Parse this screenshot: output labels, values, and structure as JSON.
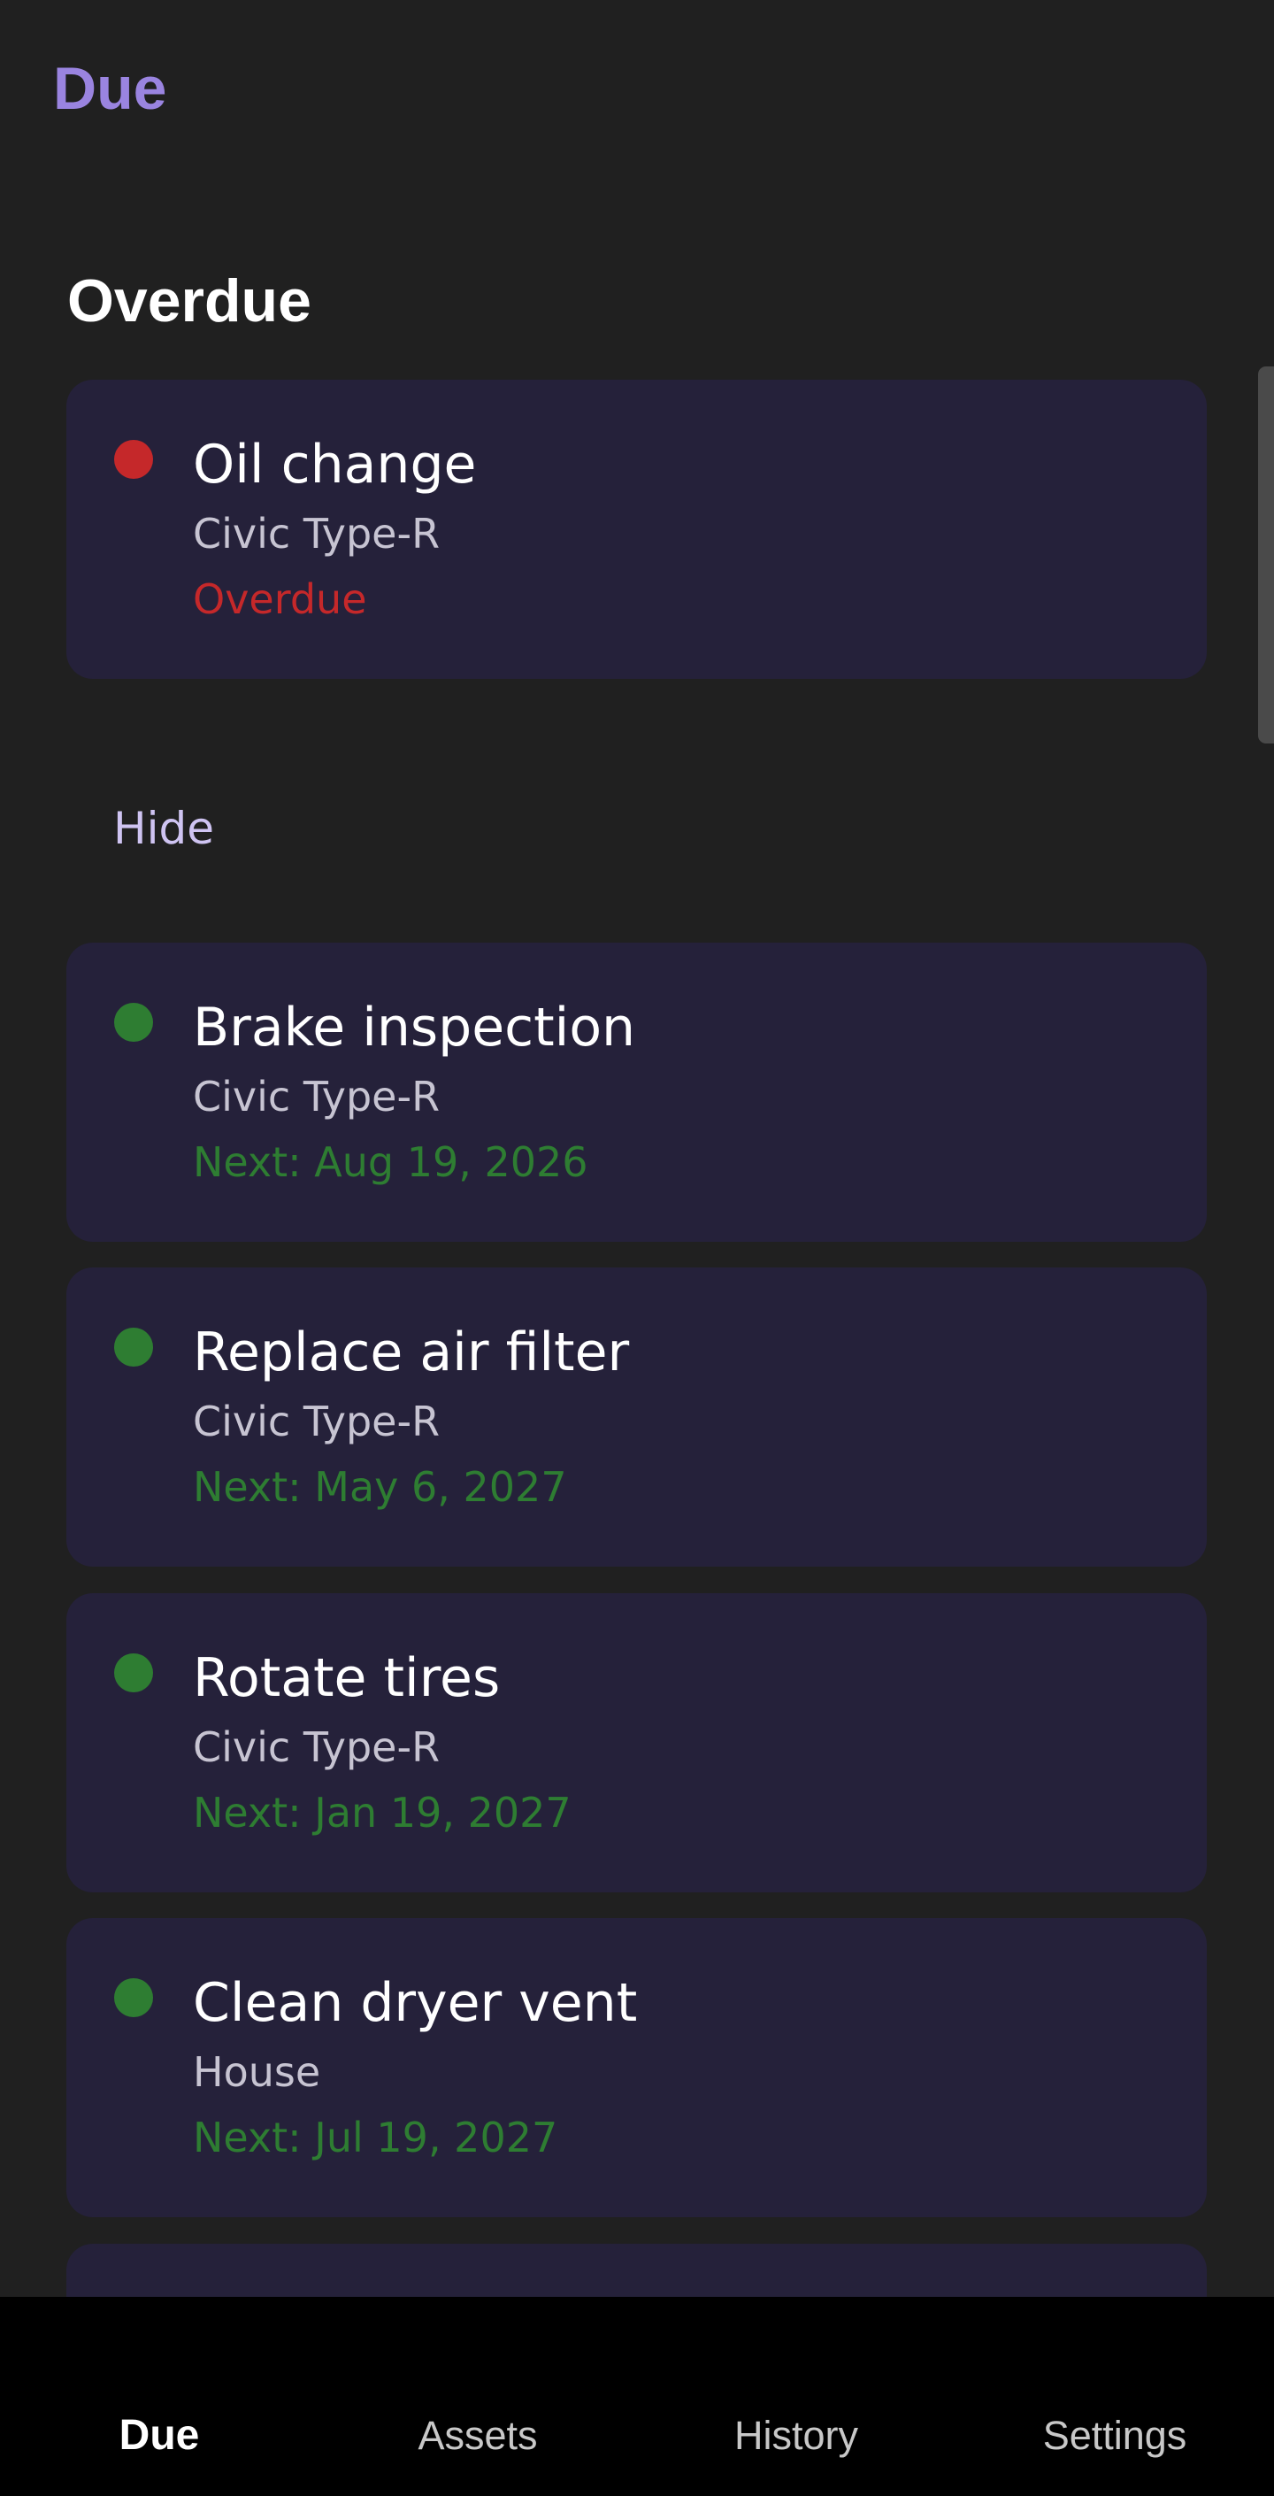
{
  "header": {
    "title": "Due"
  },
  "overdue_section": {
    "title": "Overdue",
    "items": [
      {
        "title": "Oil change",
        "asset": "Civic Type-R",
        "status": "Overdue",
        "status_color": "#c5282a"
      }
    ]
  },
  "toggle": {
    "label": "Hide"
  },
  "upcoming": {
    "items": [
      {
        "title": "Brake inspection",
        "asset": "Civic Type-R",
        "next": "Next: Aug 19, 2026"
      },
      {
        "title": "Replace air filter",
        "asset": "Civic Type-R",
        "next": "Next: May 6, 2027"
      },
      {
        "title": "Rotate tires",
        "asset": "Civic Type-R",
        "next": "Next: Jan 19, 2027"
      },
      {
        "title": "Clean dryer vent",
        "asset": "House",
        "next": "Next: Jul 19, 2027"
      }
    ]
  },
  "nav": {
    "items": [
      {
        "label": "Due",
        "active": true
      },
      {
        "label": "Assets",
        "active": false
      },
      {
        "label": "History",
        "active": false
      },
      {
        "label": "Settings",
        "active": false
      }
    ]
  },
  "colors": {
    "accent": "#9a84e0",
    "card_bg": "#25213a",
    "ok": "#2e7d32",
    "overdue": "#c5282a",
    "background": "#202020"
  }
}
